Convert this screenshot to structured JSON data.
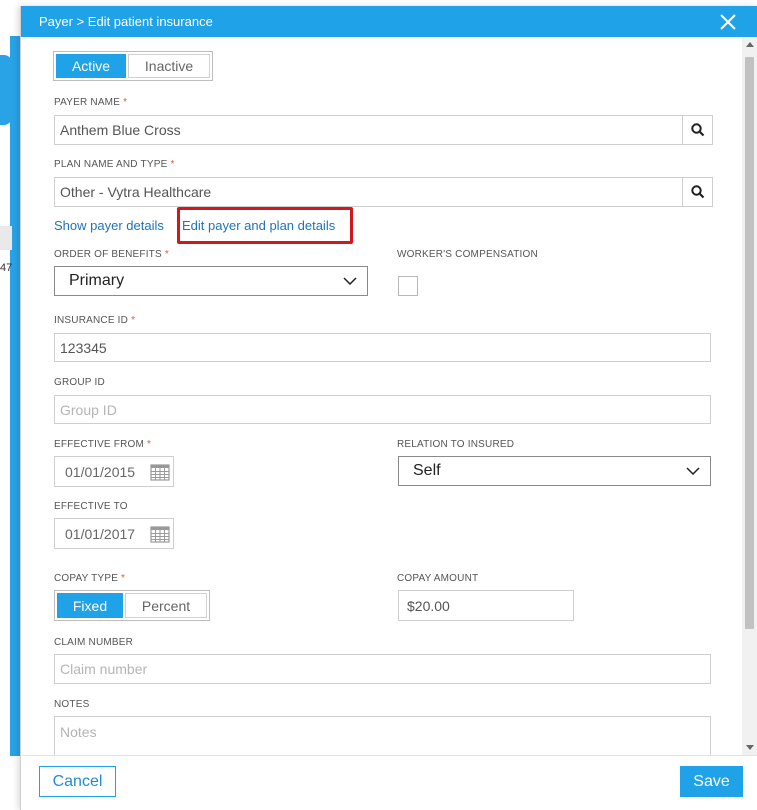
{
  "background": {
    "row_number": "47"
  },
  "modal": {
    "title": "Payer > Edit patient insurance"
  },
  "status_toggle": {
    "active_label": "Active",
    "inactive_label": "Inactive",
    "selected": "Active"
  },
  "payer_name": {
    "label": "PAYER NAME",
    "required_mark": "*",
    "value": "Anthem Blue Cross"
  },
  "plan_name": {
    "label": "PLAN NAME AND TYPE",
    "required_mark": "*",
    "value": "Other - Vytra Healthcare"
  },
  "links": {
    "show_payer_details": "Show payer details",
    "edit_payer_plan_details": "Edit payer and plan details"
  },
  "order_of_benefits": {
    "label": "ORDER OF BENEFITS",
    "required_mark": "*",
    "value": "Primary"
  },
  "workers_comp": {
    "label": "WORKER'S COMPENSATION",
    "checked": false
  },
  "insurance_id": {
    "label": "INSURANCE ID",
    "required_mark": "*",
    "value": "123345"
  },
  "group_id": {
    "label": "GROUP ID",
    "placeholder": "Group ID"
  },
  "effective_from": {
    "label": "EFFECTIVE FROM",
    "required_mark": "*",
    "value": "01/01/2015"
  },
  "relation_to_insured": {
    "label": "RELATION TO INSURED",
    "value": "Self"
  },
  "effective_to": {
    "label": "EFFECTIVE TO",
    "value": "01/01/2017"
  },
  "copay_type": {
    "label": "COPAY TYPE",
    "required_mark": "*",
    "fixed_label": "Fixed",
    "percent_label": "Percent",
    "selected": "Fixed"
  },
  "copay_amount": {
    "label": "COPAY AMOUNT",
    "value": "$20.00"
  },
  "claim_number": {
    "label": "CLAIM NUMBER",
    "placeholder": "Claim number"
  },
  "notes": {
    "label": "NOTES",
    "placeholder": "Notes"
  },
  "footer": {
    "cancel_label": "Cancel",
    "save_label": "Save"
  },
  "colors": {
    "accent": "#1fa2e8",
    "highlight_box": "#d0181e",
    "required": "#e05b2b",
    "link": "#1f73b7"
  },
  "icons": {
    "close": "close-icon",
    "search": "search-icon",
    "chevron": "chevron-down-icon",
    "calendar": "calendar-icon"
  }
}
